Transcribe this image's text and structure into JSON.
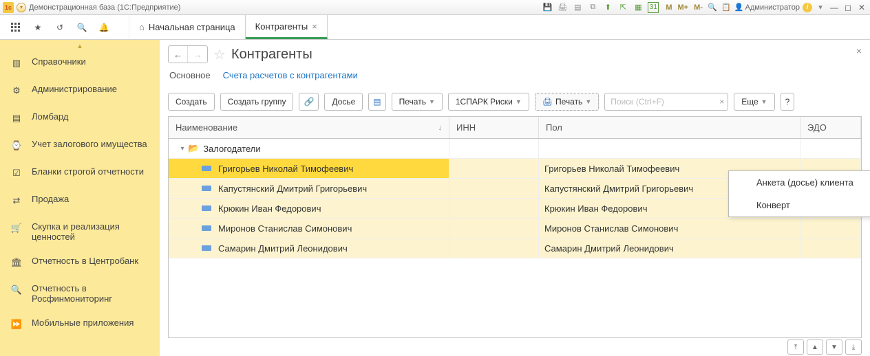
{
  "titlebar": {
    "title": "Демонстрационная база  (1С:Предприятие)",
    "user": "Администратор",
    "m_buttons": [
      "M",
      "M+",
      "M-"
    ]
  },
  "tabs": {
    "home": "Начальная страница",
    "active": "Контрагенты"
  },
  "sidebar": {
    "items": [
      "Справочники",
      "Администрирование",
      "Ломбард",
      "Учет залогового имущества",
      "Бланки строгой отчетности",
      "Продажа",
      "Скупка и реализация ценностей",
      "Отчетность в Центробанк",
      "Отчетность в Росфинмониторинг",
      "Мобильные приложения"
    ]
  },
  "page": {
    "title": "Контрагенты",
    "subtabs": {
      "main": "Основное",
      "link": "Счета расчетов с контрагентами"
    }
  },
  "toolbar": {
    "create": "Создать",
    "create_group": "Создать группу",
    "dossier": "Досье",
    "print": "Печать",
    "spark": "1СПАРК Риски",
    "print2": "Печать",
    "more": "Еще",
    "help": "?",
    "search_placeholder": "Поиск (Ctrl+F)"
  },
  "dropdown": {
    "items": [
      "Анкета (досье) клиента",
      "Конверт"
    ]
  },
  "grid": {
    "headers": {
      "name": "Наименование",
      "inn": "ИНН",
      "full": "Пол",
      "edo": "ЭДО"
    },
    "group": "Залогодатели",
    "rows": [
      {
        "name": "Григорьев Николай Тимофеевич",
        "full": "Григорьев Николай Тимофеевич",
        "selected": true
      },
      {
        "name": "Капустянский Дмитрий Григорьевич",
        "full": "Капустянский Дмитрий Григорьевич"
      },
      {
        "name": "Крюкин Иван Федорович",
        "full": "Крюкин Иван Федорович"
      },
      {
        "name": "Миронов Станислав Симонович",
        "full": "Миронов Станислав Симонович"
      },
      {
        "name": "Самарин Дмитрий Леонидович",
        "full": "Самарин Дмитрий Леонидович"
      }
    ]
  }
}
